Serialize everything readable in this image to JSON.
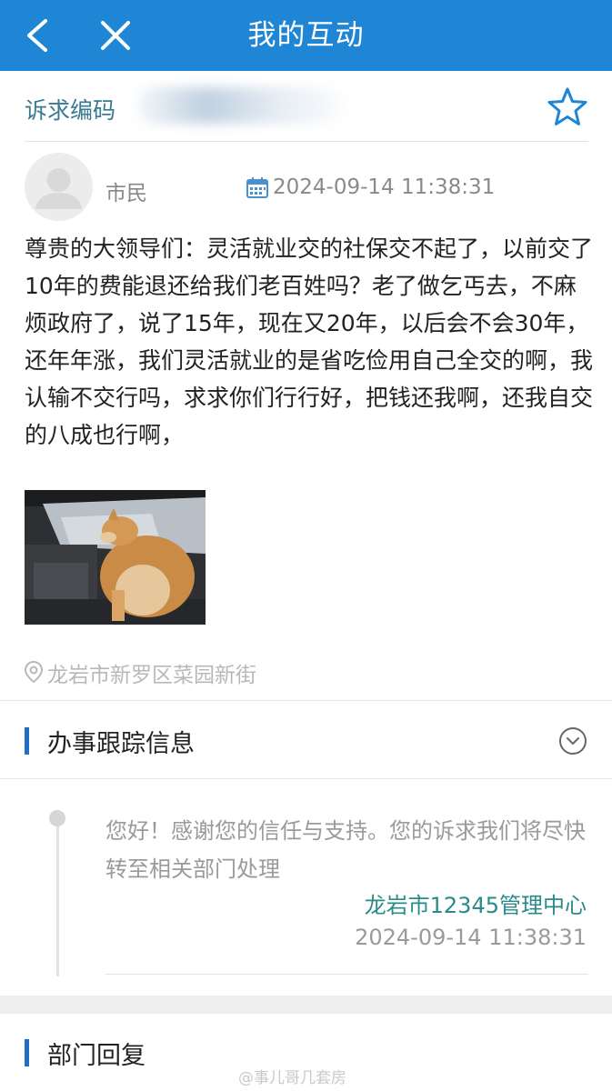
{
  "header": {
    "title": "我的互动",
    "back_icon": "chevron-left-icon",
    "close_icon": "close-icon",
    "bg_color": "#1f86d6"
  },
  "appeal": {
    "code_label": "诉求编码",
    "favorite_icon": "star-outline-icon"
  },
  "post": {
    "author": "市民",
    "datetime": "2024-09-14 11:38:31",
    "content": "尊贵的大领导们：灵活就业交的社保交不起了，以前交了10年的费能退还给我们老百姓吗？老了做乞丐去，不麻烦政府了，说了15年，现在又20年，以后会不会30年，还年年涨，我们灵活就业的是省吃俭用自己全交的啊，我认输不交行吗，求求你们行行好，把钱还我啊，还我自交的八成也行啊，",
    "location": "龙岩市新罗区菜园新街"
  },
  "tracking": {
    "title": "办事跟踪信息",
    "toggle_icon": "chevron-down-circle-icon",
    "entries": [
      {
        "message": "您好！感谢您的信任与支持。您的诉求我们将尽快转至相关部门处理",
        "org": "龙岩市12345管理中心",
        "datetime": "2024-09-14 11:38:31"
      }
    ]
  },
  "department_reply": {
    "title": "部门回复"
  },
  "watermark": "@事儿哥几套房",
  "colors": {
    "accent": "#1f6fc7",
    "org_text": "#2b8a8a",
    "code_label": "#3a7a92"
  }
}
